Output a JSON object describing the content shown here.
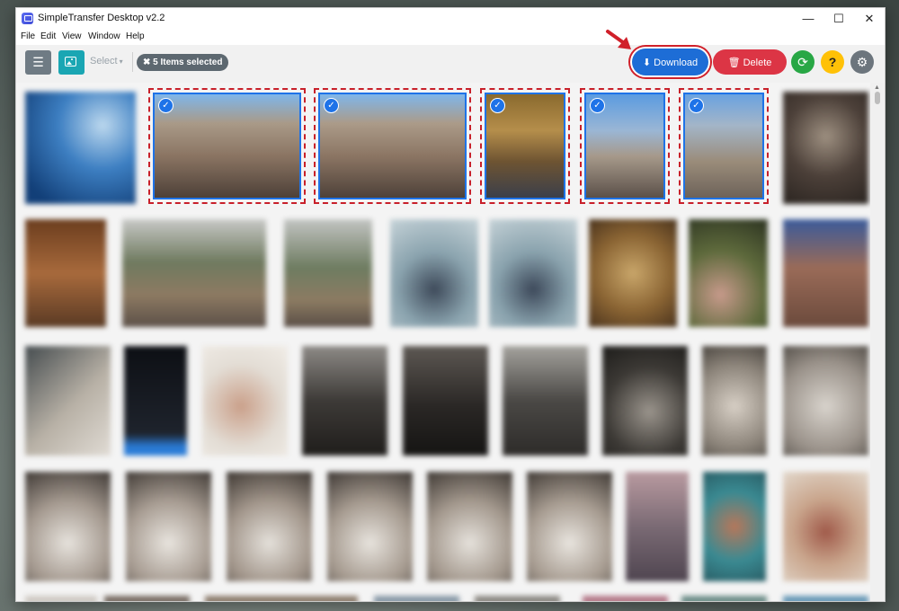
{
  "window": {
    "title": "SimpleTransfer Desktop v2.2",
    "controls": {
      "minimize": "—",
      "maximize": "☐",
      "close": "✕"
    }
  },
  "menu": [
    "File",
    "Edit",
    "View",
    "Window",
    "Help"
  ],
  "toolbar": {
    "menu_icon": "☰",
    "photo_icon": "photo-icon",
    "select_label": "Select",
    "select_caret": "▾",
    "selected_badge": "✖ 5 Items selected",
    "download_label": "⬇ Download",
    "delete_label": "🗑 Delete",
    "refresh_icon": "⟳",
    "help_icon": "?",
    "settings_icon": "⚙"
  },
  "colors": {
    "accent": "#1d6dd6",
    "delete": "#dc3545",
    "refresh": "#28a745",
    "help": "#ffc107",
    "settings": "#6c757d",
    "highlight": "#c8202a"
  },
  "selection": {
    "count": 5,
    "check_icon": "✓"
  }
}
